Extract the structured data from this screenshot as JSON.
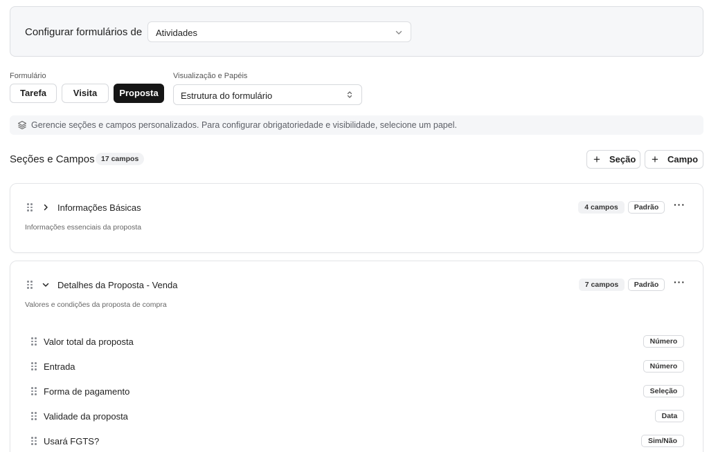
{
  "header": {
    "title": "Configurar formulários de",
    "entity_select": "Atividades"
  },
  "form_group": {
    "label": "Formulário",
    "options": [
      "Tarefa",
      "Visita",
      "Proposta"
    ],
    "active": "Proposta"
  },
  "view_group": {
    "label": "Visualização e Papéis",
    "select": "Estrutura do formulário"
  },
  "info_text": "Gerencie seções e campos personalizados. Para configurar obrigatoriedade e visibilidade, selecione um papel.",
  "sections_header": {
    "title": "Seções e Campos",
    "count": "17 campos",
    "add_section": "Seção",
    "add_field": "Campo"
  },
  "sections": [
    {
      "title": "Informações Básicas",
      "description": "Informações essenciais da proposta",
      "count": "4 campos",
      "badge": "Padrão",
      "expanded": false
    },
    {
      "title": "Detalhes da Proposta - Venda",
      "description": "Valores e condições da proposta de compra",
      "count": "7 campos",
      "badge": "Padrão",
      "expanded": true,
      "fields": [
        {
          "name": "Valor total da proposta",
          "type": "Número"
        },
        {
          "name": "Entrada",
          "type": "Número"
        },
        {
          "name": "Forma de pagamento",
          "type": "Seleção"
        },
        {
          "name": "Validade da proposta",
          "type": "Data"
        },
        {
          "name": "Usará FGTS?",
          "type": "Sim/Não"
        }
      ]
    }
  ],
  "icons": {
    "chevron_down": "chevron-down-icon",
    "chevron_updown": "chevron-up-down-icon",
    "layers": "layers-icon",
    "plus": "plus-icon",
    "grip": "grip-vertical-icon",
    "chevron_right": "chevron-right-icon",
    "more": "more-horizontal-icon"
  }
}
